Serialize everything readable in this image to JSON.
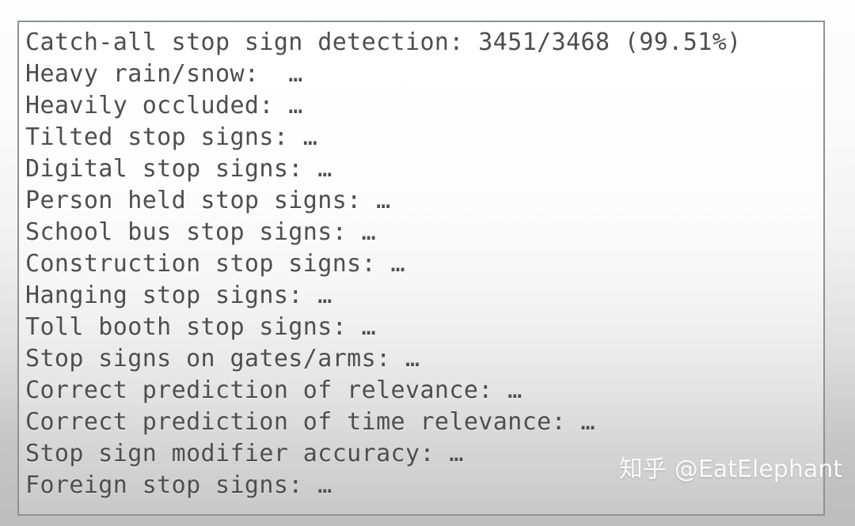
{
  "panel": {
    "border_color": "#8e9193",
    "text_color": "#4e4e4e",
    "background_top": "#ffffff",
    "background_bottom": "#c9c9c9"
  },
  "metrics": [
    {
      "label": "Catch-all stop sign detection:",
      "value": "3451/3468 (99.51%)",
      "line": "Catch-all stop sign detection: 3451/3468 (99.51%)"
    },
    {
      "label": "Heavy rain/snow:",
      "value": "…",
      "line": "Heavy rain/snow:  …"
    },
    {
      "label": "Heavily occluded:",
      "value": "…",
      "line": "Heavily occluded: …"
    },
    {
      "label": "Tilted stop signs:",
      "value": "…",
      "line": "Tilted stop signs: …"
    },
    {
      "label": "Digital stop signs:",
      "value": "…",
      "line": "Digital stop signs: …"
    },
    {
      "label": "Person held stop signs:",
      "value": "…",
      "line": "Person held stop signs: …"
    },
    {
      "label": "School bus stop signs:",
      "value": "…",
      "line": "School bus stop signs: …"
    },
    {
      "label": "Construction stop signs:",
      "value": "…",
      "line": "Construction stop signs: …"
    },
    {
      "label": "Hanging stop signs:",
      "value": "…",
      "line": "Hanging stop signs: …"
    },
    {
      "label": "Toll booth stop signs:",
      "value": "…",
      "line": "Toll booth stop signs: …"
    },
    {
      "label": "Stop signs on gates/arms:",
      "value": "…",
      "line": "Stop signs on gates/arms: …"
    },
    {
      "label": "Correct prediction of relevance:",
      "value": "…",
      "line": "Correct prediction of relevance: …"
    },
    {
      "label": "Correct prediction of time relevance:",
      "value": "…",
      "line": "Correct prediction of time relevance: …"
    },
    {
      "label": "Stop sign modifier accuracy:",
      "value": "…",
      "line": "Stop sign modifier accuracy: …"
    },
    {
      "label": "Foreign stop signs:",
      "value": "…",
      "line": "Foreign stop signs: …"
    }
  ],
  "watermark": {
    "logo": "知乎",
    "handle": "@EatElephant",
    "color": "#ffffff"
  }
}
